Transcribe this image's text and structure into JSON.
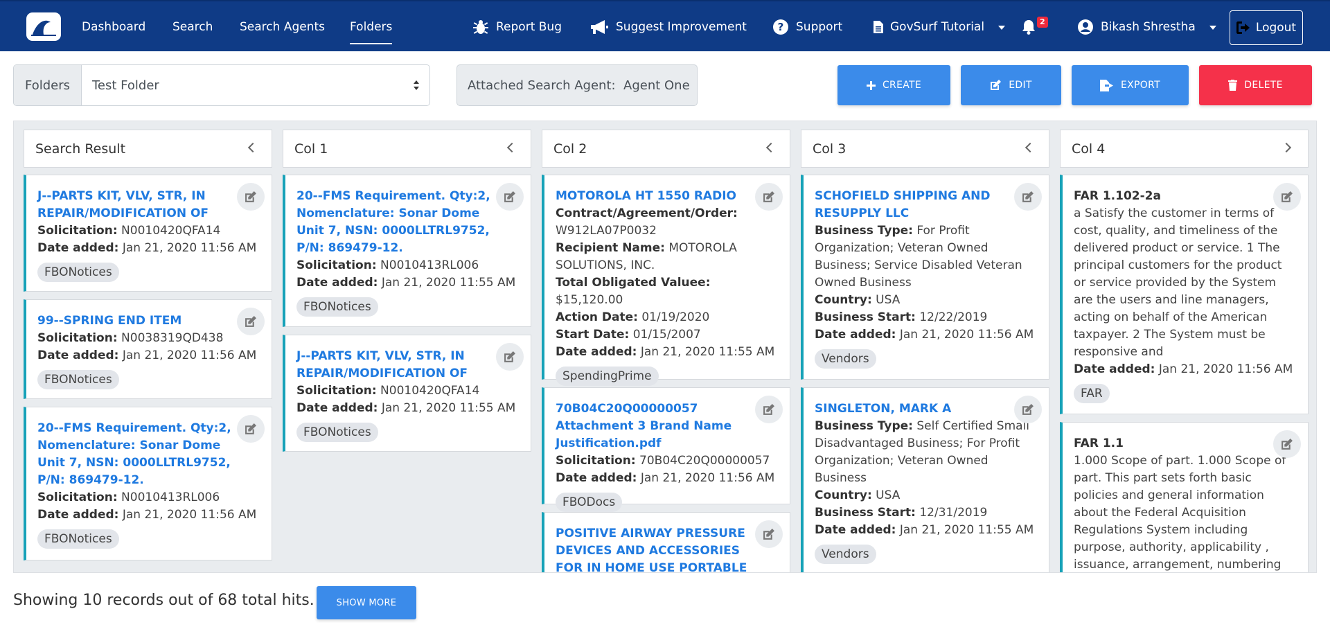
{
  "nav": {
    "links": [
      "Dashboard",
      "Search",
      "Search Agents",
      "Folders"
    ],
    "report_bug": "Report Bug",
    "suggest": "Suggest Improvement",
    "support": "Support",
    "tutorial": "GovSurf Tutorial",
    "notifications": "2",
    "user": "Bikash Shrestha",
    "logout": "Logout"
  },
  "toolbar": {
    "folders_label": "Folders",
    "folder_value": "Test Folder",
    "attached": "Attached Search Agent:  Agent One",
    "create": "CREATE",
    "edit": "EDIT",
    "export": "EXPORT",
    "delete": "DELETE"
  },
  "columns": [
    {
      "title": "Search Result",
      "cards": [
        {
          "title": "J--PARTS KIT, VLV, STR, IN REPAIR/MODIFICATION OF",
          "lines": [
            [
              "Solicitation:",
              "N0010420QFA14"
            ],
            [
              "Date added:",
              "Jan 21, 2020 11:56 AM"
            ]
          ],
          "tag": "FBONotices"
        },
        {
          "title": "99--SPRING END ITEM",
          "lines": [
            [
              "Solicitation:",
              "N0038319QD438"
            ],
            [
              "Date added:",
              "Jan 21, 2020 11:56 AM"
            ]
          ],
          "tag": "FBONotices"
        },
        {
          "title": "20--FMS Requirement. Qty:2, Nomenclature: Sonar Dome Unit 7, NSN: 0000LLTRL9752, P/N: 869479-12.",
          "lines": [
            [
              "Solicitation:",
              "N0010413RL006"
            ],
            [
              "Date added:",
              "Jan 21, 2020 11:56 AM"
            ]
          ],
          "tag": "FBONotices"
        }
      ]
    },
    {
      "title": "Col 1",
      "cards": [
        {
          "title": "20--FMS Requirement. Qty:2, Nomenclature: Sonar Dome Unit 7, NSN: 0000LLTRL9752, P/N: 869479-12.",
          "lines": [
            [
              "Solicitation:",
              "N0010413RL006"
            ],
            [
              "Date added:",
              "Jan 21, 2020 11:55 AM"
            ]
          ],
          "tag": "FBONotices"
        },
        {
          "title": "J--PARTS KIT, VLV, STR, IN REPAIR/MODIFICATION OF",
          "lines": [
            [
              "Solicitation:",
              "N0010420QFA14"
            ],
            [
              "Date added:",
              "Jan 21, 2020 11:55 AM"
            ]
          ],
          "tag": "FBONotices"
        }
      ]
    },
    {
      "title": "Col 2",
      "cards": [
        {
          "title": "MOTOROLA HT 1550 RADIO",
          "lines": [
            [
              "Contract/Agreement/Order:",
              "W912LA07P0032"
            ],
            [
              "Recipient Name:",
              "MOTOROLA SOLUTIONS, INC."
            ],
            [
              "Total Obligated Valuee:",
              "$15,120.00"
            ],
            [
              "Action Date:",
              "01/19/2020"
            ],
            [
              "Start Date:",
              "01/15/2007"
            ],
            [
              "Date added:",
              "Jan 21, 2020 11:55 AM"
            ]
          ],
          "tag": "SpendingPrime"
        },
        {
          "title": "70B04C20Q00000057 Attachment 3 Brand Name Justification.pdf",
          "lines": [
            [
              "Solicitation:",
              "70B04C20Q00000057"
            ],
            [
              "Date added:",
              "Jan 21, 2020 11:56 AM"
            ]
          ],
          "tag": "FBODocs"
        },
        {
          "title": "POSITIVE AIRWAY PRESSURE DEVICES AND ACCESSORIES FOR IN HOME USE PORTABLE",
          "lines": [],
          "tag": ""
        }
      ]
    },
    {
      "title": "Col 3",
      "cards": [
        {
          "title": "SCHOFIELD SHIPPING AND RESUPPLY LLC",
          "lines": [
            [
              "Business Type:",
              "For Profit Organization; Veteran Owned Business; Service Disabled Veteran Owned Business"
            ],
            [
              "Country:",
              "USA"
            ],
            [
              "Business Start:",
              "12/22/2019"
            ],
            [
              "Date added:",
              "Jan 21, 2020 11:56 AM"
            ]
          ],
          "tag": "Vendors"
        },
        {
          "title": "SINGLETON, MARK A",
          "lines": [
            [
              "Business Type:",
              "Self Certified Small Disadvantaged Business; For Profit Organization; Veteran Owned Business"
            ],
            [
              "Country:",
              "USA"
            ],
            [
              "Business Start:",
              "12/31/2019"
            ],
            [
              "Date added:",
              "Jan 21, 2020 11:55 AM"
            ]
          ],
          "tag": "Vendors"
        }
      ]
    },
    {
      "title": "Col 4",
      "cards": [
        {
          "title": "FAR 1.102-2a",
          "body": "a Satisfy the customer in terms of cost, quality, and timeliness of the delivered product or service. 1 The principal customers for the product or service provided by the System are the users and line managers, acting on behalf of the American taxpayer. 2 The System must be responsive and",
          "lines": [
            [
              "Date added:",
              "Jan 21, 2020 11:56 AM"
            ]
          ],
          "tag": "FAR"
        },
        {
          "title": "FAR 1.1",
          "body": "1.000 Scope of part. 1.000 Scope of part. This part sets forth basic policies and general information about the Federal Acquisition Regulations System including purpose, authority, applicability , issuance, arrangement, numbering",
          "lines": [],
          "tag": ""
        }
      ]
    }
  ],
  "footer": {
    "showing": "Showing 10 records out of 68 total hits.",
    "show_more": "SHOW MORE"
  }
}
